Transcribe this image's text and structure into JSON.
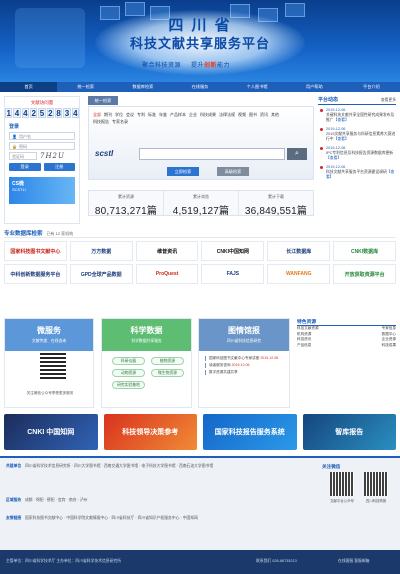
{
  "banner": {
    "title_line1": "四 川 省",
    "title_line2": "科技文献共享服务平台",
    "slogan_a": "聚合科技资源",
    "slogan_b_prefix": "提升",
    "slogan_b_highlight": "创新",
    "slogan_b_suffix": "能力"
  },
  "nav": [
    "首页",
    "统一检索",
    "数据库检索",
    "在线服务",
    "个人图书馆",
    "用户帮助",
    "平台介绍"
  ],
  "left": {
    "visits_label": "文献访问量",
    "visits_digits": [
      "1",
      "4",
      "4",
      "2",
      "5",
      "2",
      "8",
      "3",
      "4"
    ],
    "login_title": "登录",
    "username_placeholder": "用户名",
    "password_placeholder": "密码",
    "captcha_placeholder": "验证码",
    "captcha_text": "7H2U",
    "login_btn": "登录",
    "register_btn": "注册",
    "wechat_title": "CS微",
    "wechat_text": "SCSTL!"
  },
  "center": {
    "tab": "统一检索",
    "categories": [
      "全部",
      "期刊",
      "学位",
      "会议",
      "专利",
      "标准",
      "年鉴",
      "产品样本",
      "企业",
      "科技成果",
      "法律法规",
      "视频",
      "图书",
      "资讯",
      "其他"
    ],
    "row2": [
      "科技报告",
      "专家名录"
    ],
    "logo_text": "scstl",
    "btn_search": "立即检索",
    "btn_advanced": "高级检索"
  },
  "stats": [
    {
      "label": "累计资源",
      "value": "80,713,271篇"
    },
    {
      "label": "累计浏览",
      "value": "4,519,127篇"
    },
    {
      "label": "累计下载",
      "value": "36,849,551篇"
    }
  ],
  "right": {
    "title": "平台动态",
    "more": "查看更多",
    "news": [
      {
        "date": "2019-12-06",
        "text": "关键科技文献共享全国性研究成果发布及推广",
        "more": "【查看】"
      },
      {
        "date": "2019-12-06",
        "text": "2019文献共享服务与科研信息素养大赛进行中",
        "more": "【查看】"
      },
      {
        "date": "2019-12-06",
        "text": "IPC专利信息及科技报告资源数据库更新",
        "more": "【查看】"
      },
      {
        "date": "2019-12-06",
        "text": "科技文献共享服务平台资源建设调研",
        "more": "【查看】"
      }
    ]
  },
  "db_section": {
    "title": "专业数据库检索",
    "sub": "已有 12 家机构",
    "items": [
      "国家科技图书文献中心",
      "万方数据",
      "维普资讯",
      "CNKI中国知网",
      "长江数据库",
      "CNKI数据库",
      "中科创新数据服务平台",
      "GPD全球产品数据",
      "ProQuest",
      "FAJS",
      "WANFANG",
      "开放获取资源平台"
    ]
  },
  "panels": {
    "p1": {
      "title": "微服务",
      "sub": "文献传递、在线咨询",
      "caption": "关注微信公众号享受更多服务"
    },
    "p2": {
      "title": "科学数据",
      "sub": "科学数据共享服务",
      "pills": [
        "科研仪器",
        "植物资源",
        "动物资源",
        "微生物资源",
        "研究实验基地"
      ]
    },
    "p3": {
      "title": "图情馆报",
      "sub": "四川省科技信息研究",
      "items": [
        "国家科技图书文献中心专家讲座",
        "2019.12.06",
        "读者服务咨询",
        "2019.12.06",
        "数字资源共建共享"
      ]
    },
    "p4": {
      "title": "特色资源",
      "items": [
        "科技文献资源",
        "专家信息",
        "机构资源",
        "数据中心",
        "科技资讯",
        "企业资源",
        "产品信息",
        "科技成果"
      ]
    }
  },
  "ads": [
    "CNKI 中国知网",
    "科技领导决策参考",
    "国家科技报告服务系统",
    "智库报告"
  ],
  "footer": {
    "row1_label": "共建单位",
    "row1_text": "四川省科学技术信息研究所 · 四川大学图书馆 · 西南交通大学图书馆 · 电子科技大学图书馆 · 西南石油大学图书馆",
    "row2_label": "区域服务",
    "row2_text": "成都 · 绵阳 · 德阳 · 宜宾 · 南充 · 泸州",
    "row3_label": "友情链接",
    "row3_text": "国家科技图书文献中心 · 中国科学院文献情报中心 · 四川省科技厅 · 四川省知识产权服务中心 · 中国知网",
    "follow": "关注微信",
    "qr1": "文献平台公众号",
    "qr2": "四川科技情报",
    "bottom_left": "主管单位：四川省科学技术厅   主办单位：四川省科学技术信息研究所",
    "bottom_tel": "联系我们  028-86735213",
    "bottom_right": "在线客服   客服邮箱"
  }
}
